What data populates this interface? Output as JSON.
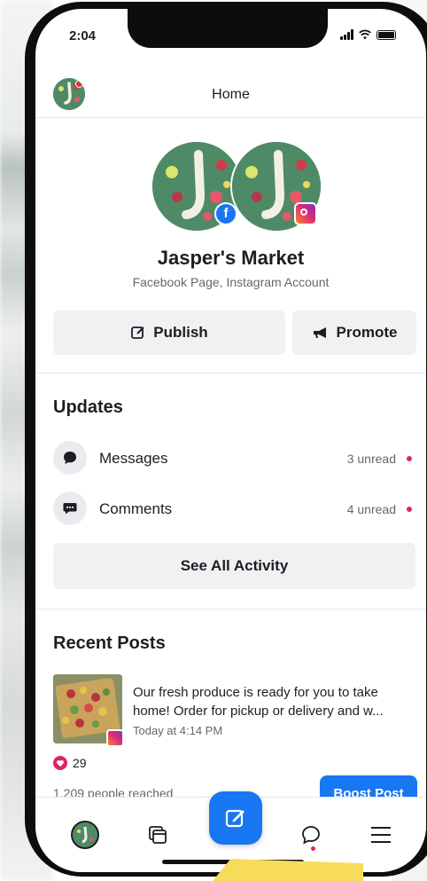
{
  "status_bar": {
    "time": "2:04"
  },
  "header": {
    "title": "Home"
  },
  "profile": {
    "name": "Jasper's Market",
    "subtitle": "Facebook Page, Instagram Account"
  },
  "actions": {
    "publish_label": "Publish",
    "promote_label": "Promote"
  },
  "updates": {
    "title": "Updates",
    "items": [
      {
        "label": "Messages",
        "count": "3 unread",
        "icon": "message-bubble-icon"
      },
      {
        "label": "Comments",
        "count": "4 unread",
        "icon": "comment-icon"
      }
    ],
    "see_all_label": "See All Activity"
  },
  "recent_posts": {
    "title": "Recent Posts",
    "post": {
      "text": "Our fresh produce is ready for you to take home! Order for pickup or delivery and w...",
      "time": "Today at 4:14 PM",
      "likes": "29",
      "reach": "1,209 people reached",
      "boost_label": "Boost Post"
    }
  },
  "tab_bar": {
    "items": [
      "profile-avatar-icon",
      "pages-icon",
      "compose-icon",
      "chat-icon",
      "menu-icon"
    ]
  },
  "colors": {
    "accent": "#1877f2",
    "notification": "#e0245e",
    "brand_green": "#4f8a66"
  }
}
